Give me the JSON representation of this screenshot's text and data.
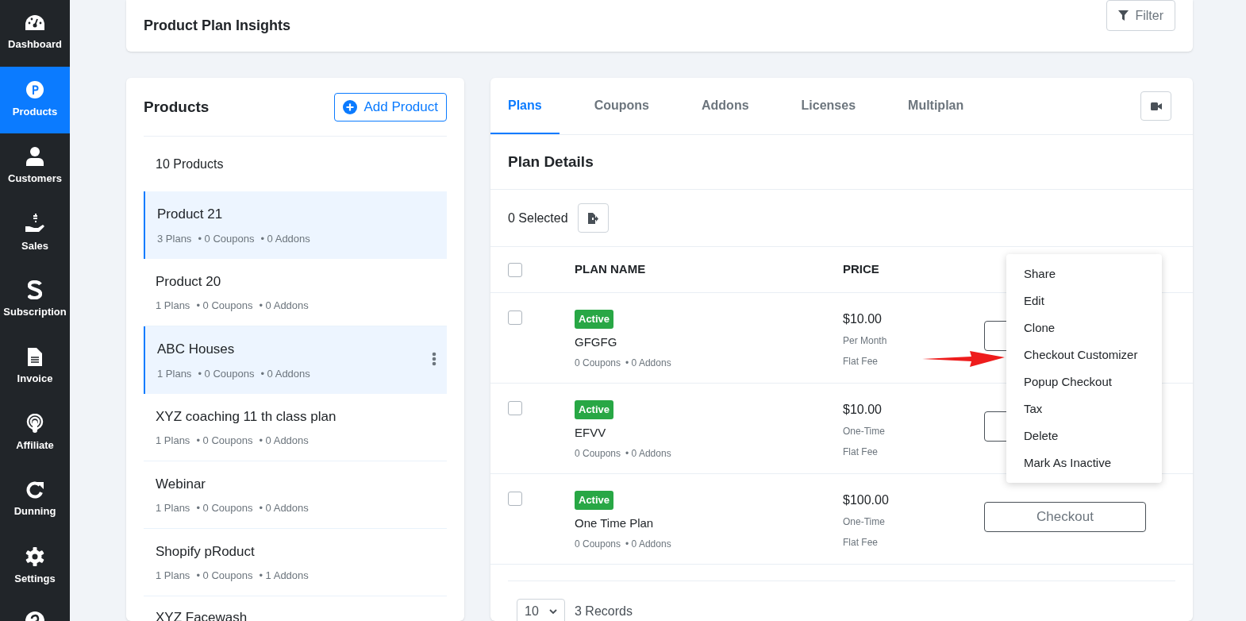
{
  "sidebar": {
    "items": [
      {
        "label": "Dashboard",
        "kind": "gauge",
        "selected": false
      },
      {
        "label": "Products",
        "kind": "p",
        "selected": true
      },
      {
        "label": "Customers",
        "kind": "user",
        "selected": false
      },
      {
        "label": "Sales",
        "kind": "sales",
        "selected": false
      },
      {
        "label": "Subscription",
        "kind": "s",
        "selected": false
      },
      {
        "label": "Invoice",
        "kind": "doc",
        "selected": false
      },
      {
        "label": "Affiliate",
        "kind": "podcast",
        "selected": false
      },
      {
        "label": "Dunning",
        "kind": "redo",
        "selected": false
      },
      {
        "label": "Settings",
        "kind": "gear",
        "selected": false
      },
      {
        "kind": "help",
        "selected": false
      }
    ]
  },
  "header": {
    "title": "Product Plan Insights",
    "filter_button": "Filter"
  },
  "products": {
    "title": "Products",
    "add_button": "Add Product",
    "count": "10 Products",
    "items": [
      {
        "name": "Product 21",
        "plans": "3 Plans",
        "coupons": "• 0 Coupons",
        "addons": "• 0 Addons",
        "selected": true,
        "menu": false
      },
      {
        "name": "Product 20",
        "plans": "1 Plans",
        "coupons": "• 0 Coupons",
        "addons": "• 0 Addons",
        "selected": false,
        "menu": false
      },
      {
        "name": "ABC Houses",
        "plans": "1 Plans",
        "coupons": "• 0 Coupons",
        "addons": "• 0 Addons",
        "selected": true,
        "menu": true
      },
      {
        "name": "XYZ coaching 11 th class plan",
        "plans": "1 Plans",
        "coupons": "• 0 Coupons",
        "addons": "• 0 Addons",
        "selected": false,
        "menu": false
      },
      {
        "name": "Webinar",
        "plans": "1 Plans",
        "coupons": "• 0 Coupons",
        "addons": "• 0 Addons",
        "selected": false,
        "menu": false
      },
      {
        "name": "Shopify pRoduct",
        "plans": "1 Plans",
        "coupons": "• 0 Coupons",
        "addons": "• 1 Addons",
        "selected": false,
        "menu": false
      },
      {
        "name": "XYZ Facewash",
        "selected": false,
        "menu": false
      }
    ]
  },
  "plans": {
    "tabs": [
      {
        "label": "Plans",
        "selected": true
      },
      {
        "label": "Coupons",
        "selected": false
      },
      {
        "label": "Addons",
        "selected": false
      },
      {
        "label": "Licenses",
        "selected": false
      },
      {
        "label": "Multiplan",
        "selected": false
      }
    ],
    "section_title": "Plan Details",
    "selected_count": "0 Selected",
    "table": {
      "columns": [
        "PLAN NAME",
        "PRICE"
      ],
      "select_all_checked": false,
      "rows": [
        {
          "checked": false,
          "status": "Active",
          "name": "GFGFG",
          "coupons": "0 Coupons",
          "addons": "• 0 Addons",
          "price": "$10.00",
          "period": "Per Month",
          "fee": "Flat Fee"
        },
        {
          "checked": false,
          "status": "Active",
          "name": "EFVV",
          "coupons": "0 Coupons",
          "addons": "• 0 Addons",
          "price": "$10.00",
          "period": "One-Time",
          "fee": "Flat Fee"
        },
        {
          "checked": false,
          "status": "Active",
          "name": "One Time Plan",
          "coupons": "0 Coupons",
          "addons": "• 0 Addons",
          "price": "$100.00",
          "period": "One-Time",
          "fee": "Flat Fee",
          "button": "Checkout"
        }
      ]
    },
    "page_size": "10",
    "records": "3 Records"
  },
  "context_menu": {
    "items": [
      "Share",
      "Edit",
      "Clone",
      "Checkout Customizer",
      "Popup Checkout",
      "Tax",
      "Delete",
      "Mark As Inactive"
    ]
  }
}
